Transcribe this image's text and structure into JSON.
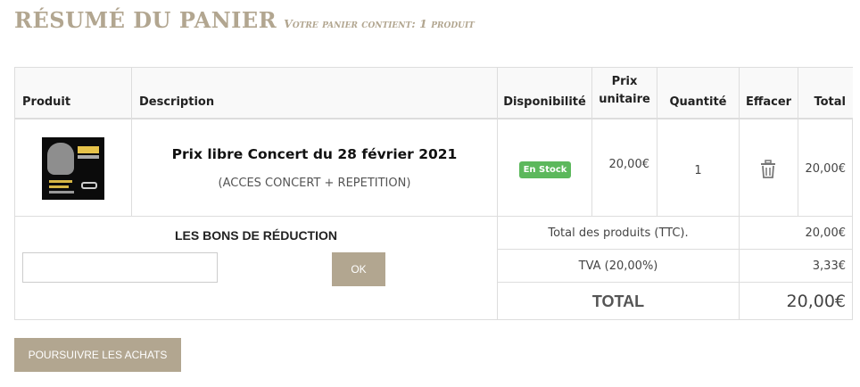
{
  "header": {
    "title": "RÉSUMÉ DU PANIER",
    "subtitle": "Votre panier contient: 1 produit"
  },
  "table": {
    "columns": {
      "product": "Produit",
      "description": "Description",
      "availability": "Disponibilité",
      "unit_price_line1": "Prix",
      "unit_price_line2": "unitaire",
      "quantity": "Quantité",
      "delete": "Effacer",
      "total": "Total"
    },
    "rows": [
      {
        "image_icon": "product-image",
        "name": "Prix libre Concert du 28 février 2021",
        "details": "(ACCES CONCERT + REPETITION)",
        "availability": "En Stock",
        "unit_price": "20,00€",
        "quantity": "1",
        "delete_icon": "trash-icon",
        "total": "20,00€"
      }
    ]
  },
  "voucher": {
    "title": "LES BONS DE RÉDUCTION",
    "input_value": "",
    "input_placeholder": "",
    "button_label": "OK"
  },
  "summary": {
    "products_total_label": "Total des produits (TTC).",
    "products_total_value": "20,00€",
    "tax_label": "TVA (20,00%)",
    "tax_value": "3,33€",
    "grand_total_label": "TOTAL",
    "grand_total_value": "20,00€"
  },
  "actions": {
    "continue_label": "POURSUIVRE LES ACHATS"
  },
  "colors": {
    "accent": "#b2a690",
    "in_stock": "#5cb85c"
  }
}
